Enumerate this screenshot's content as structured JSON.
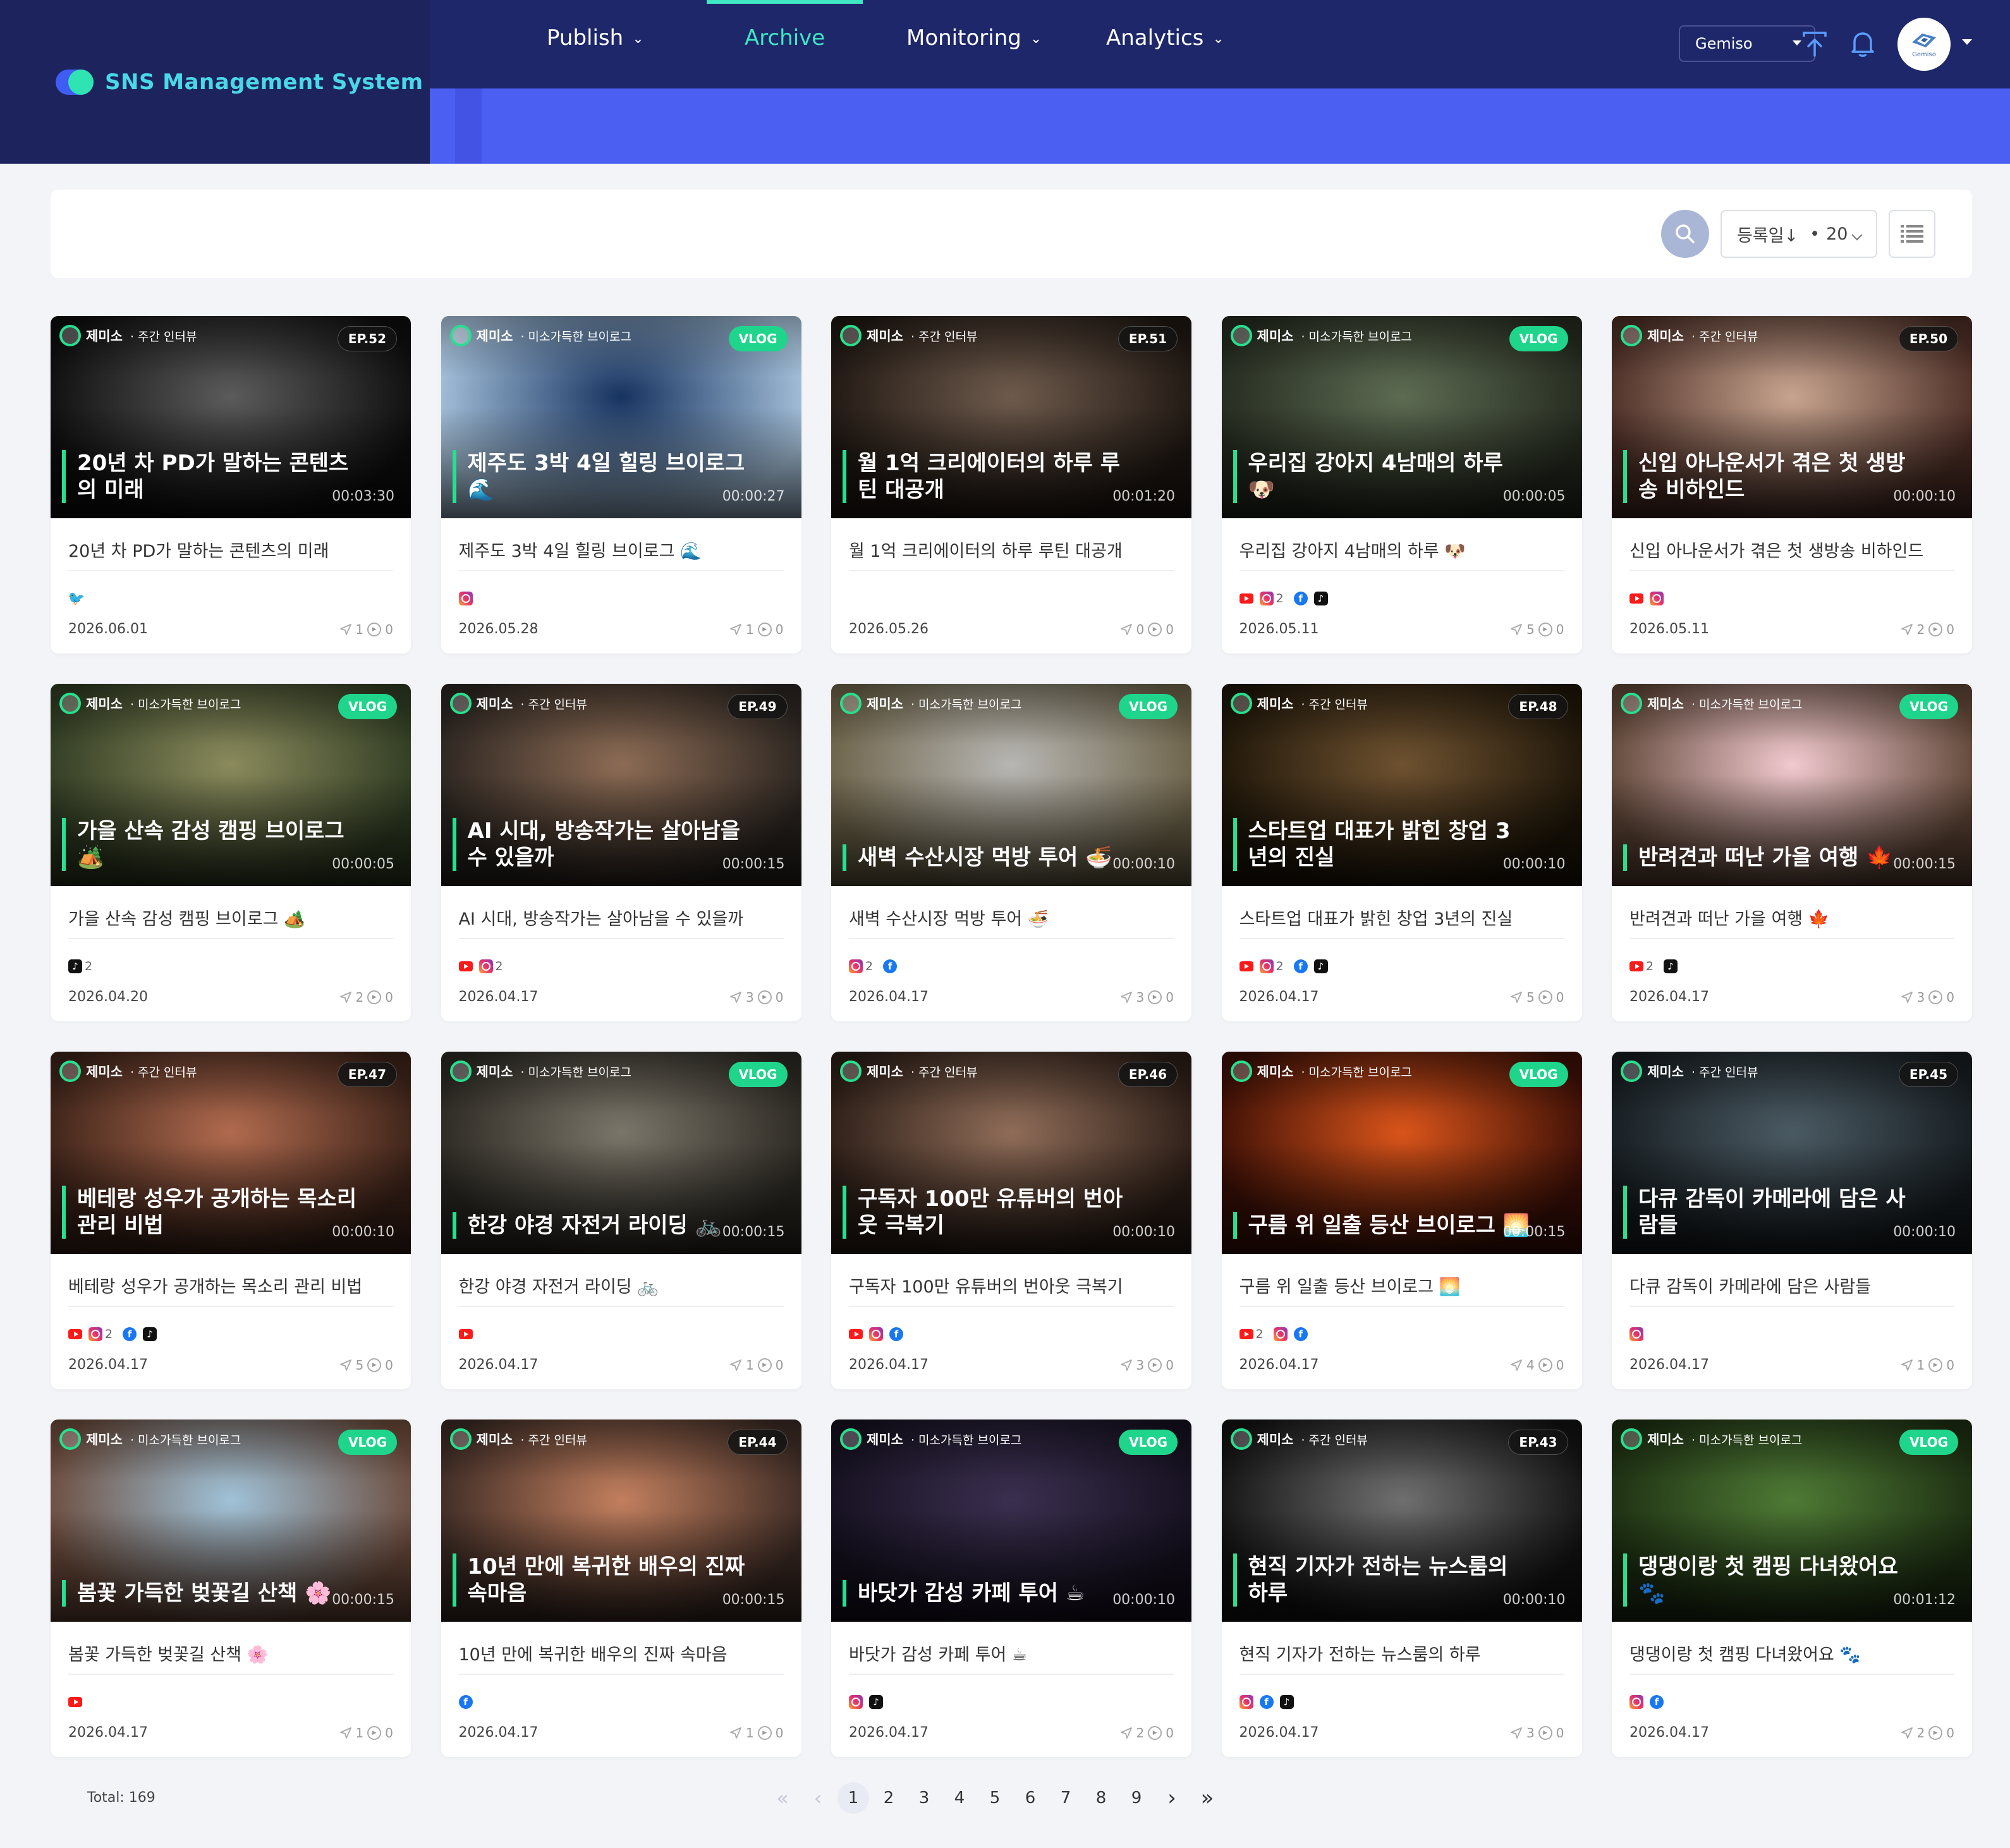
{
  "brand": {
    "title": "SNS Management System"
  },
  "nav": [
    {
      "label": "Publish",
      "has_menu": true,
      "active": false
    },
    {
      "label": "Archive",
      "has_menu": false,
      "active": true
    },
    {
      "label": "Monitoring",
      "has_menu": true,
      "active": false
    },
    {
      "label": "Analytics",
      "has_menu": true,
      "active": false
    }
  ],
  "header": {
    "workspace": "Gemiso",
    "avatar_text": "Gemiso",
    "icons": [
      "upload-icon",
      "bell-icon"
    ]
  },
  "toolbar": {
    "sort_label": "등록일↓",
    "page_size": "20",
    "icons": [
      "search-icon",
      "list-view-icon"
    ]
  },
  "cards": [
    {
      "channel": "제미소",
      "category": "주간 인터뷰",
      "badge": "EP.52",
      "badge_type": "ep",
      "overlay": "20년 차 PD가 말하는 콘텐츠의 미래",
      "duration": "00:03:30",
      "title": "20년 차 PD가 말하는 콘텐츠의 미래",
      "platforms": [
        {
          "icon": "twitter-icon",
          "type": "tw",
          "count": ""
        }
      ],
      "date": "2026.06.01",
      "shares": "1",
      "views": "0",
      "colors": [
        "#5b5b5b",
        "#0d0d0d"
      ]
    },
    {
      "channel": "제미소",
      "category": "미소가득한 브이로그",
      "badge": "VLOG",
      "badge_type": "vlog",
      "overlay": "제주도 3박 4일 힐링 브이로그 🌊",
      "duration": "00:00:27",
      "title": "제주도 3박 4일 힐링 브이로그 🌊",
      "platforms": [
        {
          "icon": "instagram-icon",
          "type": "ig",
          "count": ""
        }
      ],
      "date": "2026.05.28",
      "shares": "1",
      "views": "0",
      "colors": [
        "#16325f",
        "#a8c4dd"
      ]
    },
    {
      "channel": "제미소",
      "category": "주간 인터뷰",
      "badge": "EP.51",
      "badge_type": "ep",
      "overlay": "월 1억 크리에이터의 하루 루틴 대공개",
      "duration": "00:01:20",
      "title": "월 1억 크리에이터의 하루 루틴 대공개",
      "platforms": [],
      "date": "2026.05.26",
      "shares": "0",
      "views": "0",
      "colors": [
        "#6e5a4c",
        "#1f1712"
      ]
    },
    {
      "channel": "제미소",
      "category": "미소가득한 브이로그",
      "badge": "VLOG",
      "badge_type": "vlog",
      "overlay": "우리집 강아지 4남매의 하루 🐶",
      "duration": "00:00:05",
      "title": "우리집 강아지 4남매의 하루 🐶",
      "platforms": [
        {
          "icon": "youtube-icon",
          "type": "yt",
          "count": ""
        },
        {
          "icon": "instagram-icon",
          "type": "ig",
          "count": "2"
        },
        {
          "icon": "facebook-icon",
          "type": "fb",
          "count": ""
        },
        {
          "icon": "tiktok-icon",
          "type": "tt",
          "count": ""
        }
      ],
      "date": "2026.05.11",
      "shares": "5",
      "views": "0",
      "colors": [
        "#5d6b52",
        "#242a1f"
      ]
    },
    {
      "channel": "제미소",
      "category": "주간 인터뷰",
      "badge": "EP.50",
      "badge_type": "ep",
      "overlay": "신입 아나운서가 겪은 첫 생방송 비하인드",
      "duration": "00:00:10",
      "title": "신입 아나운서가 겪은 첫 생방송 비하인드",
      "platforms": [
        {
          "icon": "youtube-icon",
          "type": "yt",
          "count": ""
        },
        {
          "icon": "instagram-icon",
          "type": "ig",
          "count": ""
        }
      ],
      "date": "2026.05.11",
      "shares": "2",
      "views": "0",
      "colors": [
        "#c7a48f",
        "#4b2d25"
      ]
    },
    {
      "channel": "제미소",
      "category": "미소가득한 브이로그",
      "badge": "VLOG",
      "badge_type": "vlog",
      "overlay": "가을 산속 감성 캠핑 브이로그 🏕️",
      "duration": "00:00:05",
      "title": "가을 산속 감성 캠핑 브이로그 🏕️",
      "platforms": [
        {
          "icon": "tiktok-icon",
          "type": "tt",
          "count": "2"
        }
      ],
      "date": "2026.04.20",
      "shares": "2",
      "views": "0",
      "colors": [
        "#8a8a5c",
        "#2f3b22"
      ]
    },
    {
      "channel": "제미소",
      "category": "주간 인터뷰",
      "badge": "EP.49",
      "badge_type": "ep",
      "overlay": "AI 시대, 방송작가는 살아남을 수 있을까",
      "duration": "00:00:15",
      "title": "AI 시대, 방송작가는 살아남을 수 있을까",
      "platforms": [
        {
          "icon": "youtube-icon",
          "type": "yt",
          "count": ""
        },
        {
          "icon": "instagram-icon",
          "type": "ig",
          "count": "2"
        }
      ],
      "date": "2026.04.17",
      "shares": "3",
      "views": "0",
      "colors": [
        "#8c6b54",
        "#2a2420"
      ]
    },
    {
      "channel": "제미소",
      "category": "미소가득한 브이로그",
      "badge": "VLOG",
      "badge_type": "vlog",
      "overlay": "새벽 수산시장 먹방 투어 🍜",
      "duration": "00:00:10",
      "title": "새벽 수산시장 먹방 투어 🍜",
      "platforms": [
        {
          "icon": "instagram-icon",
          "type": "ig",
          "count": "2"
        },
        {
          "icon": "facebook-icon",
          "type": "fb",
          "count": ""
        }
      ],
      "date": "2026.04.17",
      "shares": "3",
      "views": "0",
      "colors": [
        "#b7b6b3",
        "#6b6147"
      ]
    },
    {
      "channel": "제미소",
      "category": "주간 인터뷰",
      "badge": "EP.48",
      "badge_type": "ep",
      "overlay": "스타트업 대표가 밝힌 창업 3년의 진실",
      "duration": "00:00:10",
      "title": "스타트업 대표가 밝힌 창업 3년의 진실",
      "platforms": [
        {
          "icon": "youtube-icon",
          "type": "yt",
          "count": ""
        },
        {
          "icon": "instagram-icon",
          "type": "ig",
          "count": "2"
        },
        {
          "icon": "facebook-icon",
          "type": "fb",
          "count": ""
        },
        {
          "icon": "tiktok-icon",
          "type": "tt",
          "count": ""
        }
      ],
      "date": "2026.04.17",
      "shares": "5",
      "views": "0",
      "colors": [
        "#6e5130",
        "#1d1508"
      ]
    },
    {
      "channel": "제미소",
      "category": "미소가득한 브이로그",
      "badge": "VLOG",
      "badge_type": "vlog",
      "overlay": "반려견과 떠난 가을 여행 🍁",
      "duration": "00:00:15",
      "title": "반려견과 떠난 가을 여행 🍁",
      "platforms": [
        {
          "icon": "youtube-icon",
          "type": "yt",
          "count": "2"
        },
        {
          "icon": "tiktok-icon",
          "type": "tt",
          "count": ""
        }
      ],
      "date": "2026.04.17",
      "shares": "3",
      "views": "0",
      "colors": [
        "#f1c9cf",
        "#5e4536"
      ]
    },
    {
      "channel": "제미소",
      "category": "주간 인터뷰",
      "badge": "EP.47",
      "badge_type": "ep",
      "overlay": "베테랑 성우가 공개하는 목소리 관리 비법",
      "duration": "00:00:10",
      "title": "베테랑 성우가 공개하는 목소리 관리 비법",
      "platforms": [
        {
          "icon": "youtube-icon",
          "type": "yt",
          "count": ""
        },
        {
          "icon": "instagram-icon",
          "type": "ig",
          "count": "2"
        },
        {
          "icon": "facebook-icon",
          "type": "fb",
          "count": ""
        },
        {
          "icon": "tiktok-icon",
          "type": "tt",
          "count": ""
        }
      ],
      "date": "2026.04.17",
      "shares": "5",
      "views": "0",
      "colors": [
        "#b06a4e",
        "#3b2218"
      ]
    },
    {
      "channel": "제미소",
      "category": "미소가득한 브이로그",
      "badge": "VLOG",
      "badge_type": "vlog",
      "overlay": "한강 야경 자전거 라이딩 🚲",
      "duration": "00:00:15",
      "title": "한강 야경 자전거 라이딩 🚲",
      "platforms": [
        {
          "icon": "youtube-icon",
          "type": "yt",
          "count": ""
        }
      ],
      "date": "2026.04.17",
      "shares": "1",
      "views": "0",
      "colors": [
        "#7a7569",
        "#2b2822"
      ]
    },
    {
      "channel": "제미소",
      "category": "주간 인터뷰",
      "badge": "EP.46",
      "badge_type": "ep",
      "overlay": "구독자 100만 유튜버의 번아웃 극복기",
      "duration": "00:00:10",
      "title": "구독자 100만 유튜버의 번아웃 극복기",
      "platforms": [
        {
          "icon": "youtube-icon",
          "type": "yt",
          "count": ""
        },
        {
          "icon": "instagram-icon",
          "type": "ig",
          "count": ""
        },
        {
          "icon": "facebook-icon",
          "type": "fb",
          "count": ""
        }
      ],
      "date": "2026.04.17",
      "shares": "3",
      "views": "0",
      "colors": [
        "#8f6c58",
        "#2b1d16"
      ]
    },
    {
      "channel": "제미소",
      "category": "미소가득한 브이로그",
      "badge": "VLOG",
      "badge_type": "vlog",
      "overlay": "구름 위 일출 등산 브이로그 🌅",
      "duration": "00:00:15",
      "title": "구름 위 일출 등산 브이로그 🌅",
      "platforms": [
        {
          "icon": "youtube-icon",
          "type": "yt",
          "count": "2"
        },
        {
          "icon": "instagram-icon",
          "type": "ig",
          "count": ""
        },
        {
          "icon": "facebook-icon",
          "type": "fb",
          "count": ""
        }
      ],
      "date": "2026.04.17",
      "shares": "4",
      "views": "0",
      "colors": [
        "#d9541a",
        "#3b0f06"
      ]
    },
    {
      "channel": "제미소",
      "category": "주간 인터뷰",
      "badge": "EP.45",
      "badge_type": "ep",
      "overlay": "다큐 감독이 카메라에 담은 사람들",
      "duration": "00:00:10",
      "title": "다큐 감독이 카메라에 담은 사람들",
      "platforms": [
        {
          "icon": "instagram-icon",
          "type": "ig",
          "count": ""
        }
      ],
      "date": "2026.04.17",
      "shares": "1",
      "views": "0",
      "colors": [
        "#4a5a63",
        "#161c20"
      ]
    },
    {
      "channel": "제미소",
      "category": "미소가득한 브이로그",
      "badge": "VLOG",
      "badge_type": "vlog",
      "overlay": "봄꽃 가득한 벚꽃길 산책 🌸",
      "duration": "00:00:15",
      "title": "봄꽃 가득한 벚꽃길 산책 🌸",
      "platforms": [
        {
          "icon": "youtube-icon",
          "type": "yt",
          "count": ""
        }
      ],
      "date": "2026.04.17",
      "shares": "1",
      "views": "0",
      "colors": [
        "#9fc2d8",
        "#6b4a3a"
      ]
    },
    {
      "channel": "제미소",
      "category": "주간 인터뷰",
      "badge": "EP.44",
      "badge_type": "ep",
      "overlay": "10년 만에 복귀한 배우의 진짜 속마음",
      "duration": "00:00:15",
      "title": "10년 만에 복귀한 배우의 진짜 속마음",
      "platforms": [
        {
          "icon": "facebook-icon",
          "type": "fb",
          "count": ""
        }
      ],
      "date": "2026.04.17",
      "shares": "1",
      "views": "0",
      "colors": [
        "#c27f5e",
        "#3b2a24"
      ]
    },
    {
      "channel": "제미소",
      "category": "미소가득한 브이로그",
      "badge": "VLOG",
      "badge_type": "vlog",
      "overlay": "바닷가 감성 카페 투어 ☕",
      "duration": "00:00:10",
      "title": "바닷가 감성 카페 투어 ☕",
      "platforms": [
        {
          "icon": "instagram-icon",
          "type": "ig",
          "count": ""
        },
        {
          "icon": "tiktok-icon",
          "type": "tt",
          "count": ""
        }
      ],
      "date": "2026.04.17",
      "shares": "2",
      "views": "0",
      "colors": [
        "#3a2f4f",
        "#15101f"
      ]
    },
    {
      "channel": "제미소",
      "category": "주간 인터뷰",
      "badge": "EP.43",
      "badge_type": "ep",
      "overlay": "현직 기자가 전하는 뉴스룸의 하루",
      "duration": "00:00:10",
      "title": "현직 기자가 전하는 뉴스룸의 하루",
      "platforms": [
        {
          "icon": "instagram-icon",
          "type": "ig",
          "count": ""
        },
        {
          "icon": "facebook-icon",
          "type": "fb",
          "count": ""
        },
        {
          "icon": "tiktok-icon",
          "type": "tt",
          "count": ""
        }
      ],
      "date": "2026.04.17",
      "shares": "3",
      "views": "0",
      "colors": [
        "#6f6f6f",
        "#121212"
      ]
    },
    {
      "channel": "제미소",
      "category": "미소가득한 브이로그",
      "badge": "VLOG",
      "badge_type": "vlog",
      "overlay": "댕댕이랑 첫 캠핑 다녀왔어요 🐾",
      "duration": "00:01:12",
      "title": "댕댕이랑 첫 캠핑 다녀왔어요 🐾",
      "platforms": [
        {
          "icon": "instagram-icon",
          "type": "ig",
          "count": ""
        },
        {
          "icon": "facebook-icon",
          "type": "fb",
          "count": ""
        }
      ],
      "date": "2026.04.17",
      "shares": "2",
      "views": "0",
      "colors": [
        "#4e7a35",
        "#1d2e12"
      ]
    }
  ],
  "footer": {
    "total": "Total: 169",
    "pages": [
      "1",
      "2",
      "3",
      "4",
      "5",
      "6",
      "7",
      "8",
      "9"
    ],
    "current_page": "1",
    "nav_icons": [
      "first-page-icon",
      "prev-page-icon",
      "next-page-icon",
      "last-page-icon"
    ]
  }
}
